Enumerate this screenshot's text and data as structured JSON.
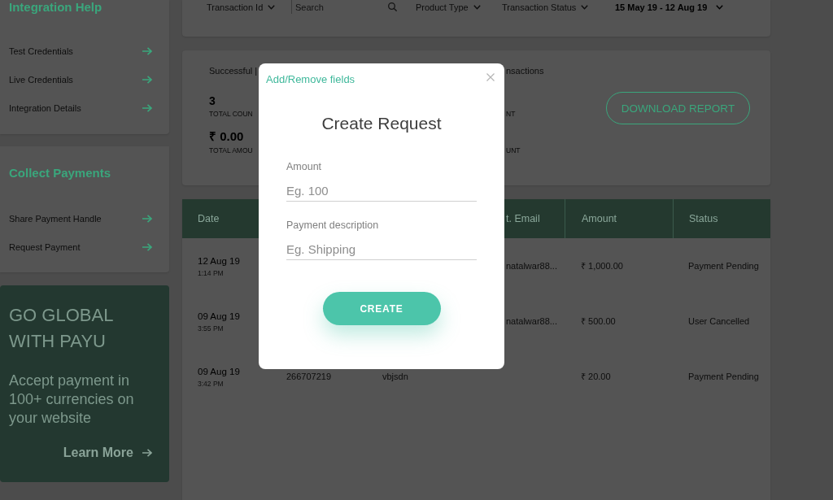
{
  "sidebar": {
    "sections": [
      {
        "title": "Integration Help",
        "items": [
          {
            "label": "Test Credentials"
          },
          {
            "label": "Live Credentials"
          },
          {
            "label": "Integration Details"
          }
        ]
      },
      {
        "title": "Collect Payments",
        "items": [
          {
            "label": "Share Payment Handle"
          },
          {
            "label": "Request Payment"
          }
        ]
      }
    ],
    "promo": {
      "title": "GO GLOBAL WITH PAYU",
      "description": "Accept payment in 100+ currencies on your website",
      "link": "Learn More"
    }
  },
  "filters": [
    {
      "kind": "dropdown",
      "label": "Transaction Id"
    },
    {
      "kind": "search",
      "placeholder": "Search"
    },
    {
      "kind": "dropdown",
      "label": "Product Type"
    },
    {
      "kind": "dropdown",
      "label": "Transaction Status"
    },
    {
      "kind": "date_range",
      "label": "15 May 19 - 12 Aug 19"
    }
  ],
  "summary": {
    "groups": [
      {
        "heading": "Successful |",
        "figures": [
          {
            "value": "3",
            "caption": "TOTAL COUN"
          },
          {
            "value": "₹ 0.00",
            "caption": "TOTAL AMOU"
          }
        ]
      },
      {
        "heading": "nsactions",
        "figures": [
          {
            "caption": "NT"
          },
          {
            "caption": "UNT"
          }
        ]
      }
    ],
    "download_button": "DOWNLOAD REPORT"
  },
  "table": {
    "columns": {
      "date": "Date",
      "column_4": "t. Email",
      "amount": "Amount",
      "status": "Status"
    },
    "rows": [
      {
        "date": "12 Aug 19",
        "time": "1:14 PM",
        "column_4": "natalwar88...",
        "amount": "₹ 1,000.00",
        "status": "Payment Pending"
      },
      {
        "date": "09 Aug 19",
        "time": "3:55 PM",
        "column_4": "natalwar88...",
        "amount": "₹ 500.00",
        "status": "User Cancelled"
      },
      {
        "date": "09 Aug 19",
        "time": "3:42 PM",
        "column_2": "266707219",
        "column_3": "vbjsdn",
        "amount": "₹ 20.00",
        "status": "Payment Pending"
      }
    ]
  },
  "modal": {
    "link": "Add/Remove fields",
    "title": "Create Request",
    "fields": [
      {
        "label": "Amount",
        "placeholder": "Eg. 100"
      },
      {
        "label": "Payment description",
        "placeholder": "Eg. Shipping"
      }
    ],
    "button": "CREATE"
  }
}
